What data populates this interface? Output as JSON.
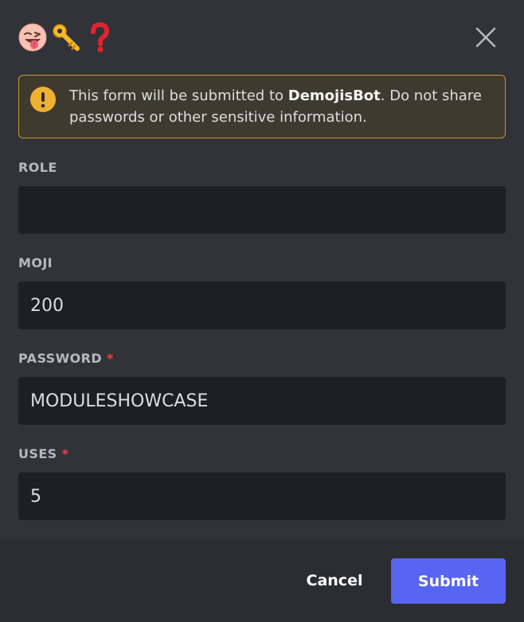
{
  "header": {
    "emojis": [
      {
        "name": "winking-face-with-tongue-icon"
      },
      {
        "name": "key-icon"
      },
      {
        "name": "red-question-mark-icon"
      }
    ],
    "close_icon": "close-icon"
  },
  "warning": {
    "icon": "exclamation-circle-icon",
    "text_before": "This form will be submitted to ",
    "bot_name": "DemojisBot",
    "text_after": ". Do not share passwords or other sensitive information."
  },
  "fields": [
    {
      "label": "ROLE",
      "required": false,
      "value": ""
    },
    {
      "label": "MOJI",
      "required": false,
      "value": "200"
    },
    {
      "label": "PASSWORD",
      "required": true,
      "value": "MODULESHOWCASE"
    },
    {
      "label": "USES",
      "required": true,
      "value": "5"
    }
  ],
  "required_marker": "*",
  "footer": {
    "cancel_label": "Cancel",
    "submit_label": "Submit"
  },
  "colors": {
    "background": "#313338",
    "footer": "#2b2d31",
    "input": "#1e1f22",
    "warning_border": "#c29a31",
    "warning_bg": "#3f3a2f",
    "accent": "#5865f2",
    "required": "#f23f43"
  }
}
